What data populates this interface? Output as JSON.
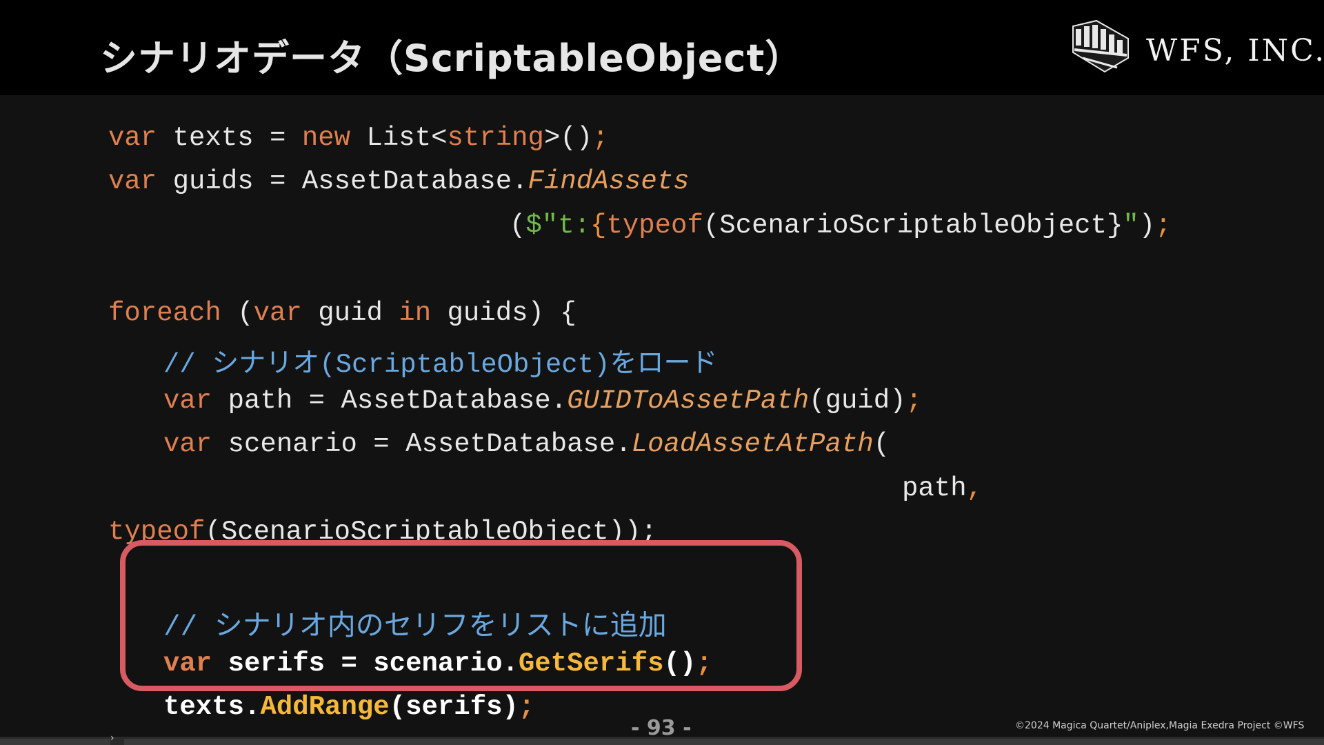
{
  "header": {
    "title": "シナリオデータ（ScriptableObject）",
    "logo_text": "WFS, INC."
  },
  "code": {
    "l1": {
      "t1": "var",
      "t2": " texts = ",
      "t3": "new",
      "t4": " List<",
      "t5": "string",
      "t6": ">()",
      "t7": ";"
    },
    "l2": {
      "t1": "var",
      "t2": " guids = AssetDatabase.",
      "t3": "FindAssets"
    },
    "l3": {
      "t1": "(",
      "t2": "$\"t:",
      "t3": "{",
      "t4": "typeof",
      "t5": "(ScenarioScriptableObject}",
      "t6": "\"",
      "t7": ")",
      "t8": ";"
    },
    "l4": {
      "t1": "foreach",
      "t2": " (",
      "t3": "var",
      "t4": " guid ",
      "t5": "in",
      "t6": " guids) {"
    },
    "l5": {
      "t1": "// シナリオ(ScriptableObject)をロード"
    },
    "l6": {
      "t1": "var",
      "t2": " path = AssetDatabase.",
      "t3": "GUIDToAssetPath",
      "t4": "(guid)",
      "t5": ";"
    },
    "l7": {
      "t1": "var",
      "t2": " scenario = AssetDatabase.",
      "t3": "LoadAssetAtPath",
      "t4": "("
    },
    "l8": {
      "t1": "path",
      "t2": ","
    },
    "l9": {
      "t1": "typeof",
      "t2": "(ScenarioScriptableObject));"
    },
    "l10": {
      "t1": "// シナリオ内のセリフをリストに追加"
    },
    "l11": {
      "t1": "var",
      "t2": " serifs = scenario.",
      "t3": "GetSerifs",
      "t4": "()",
      "t5": ";"
    },
    "l12": {
      "t1": "texts.",
      "t2": "AddRange",
      "t3": "(serifs)",
      "t4": ";"
    }
  },
  "footer": {
    "page_number": "- 93 -",
    "copyright": "©2024 Magica Quartet/Aniplex,Magia Exedra Project ©WFS"
  }
}
